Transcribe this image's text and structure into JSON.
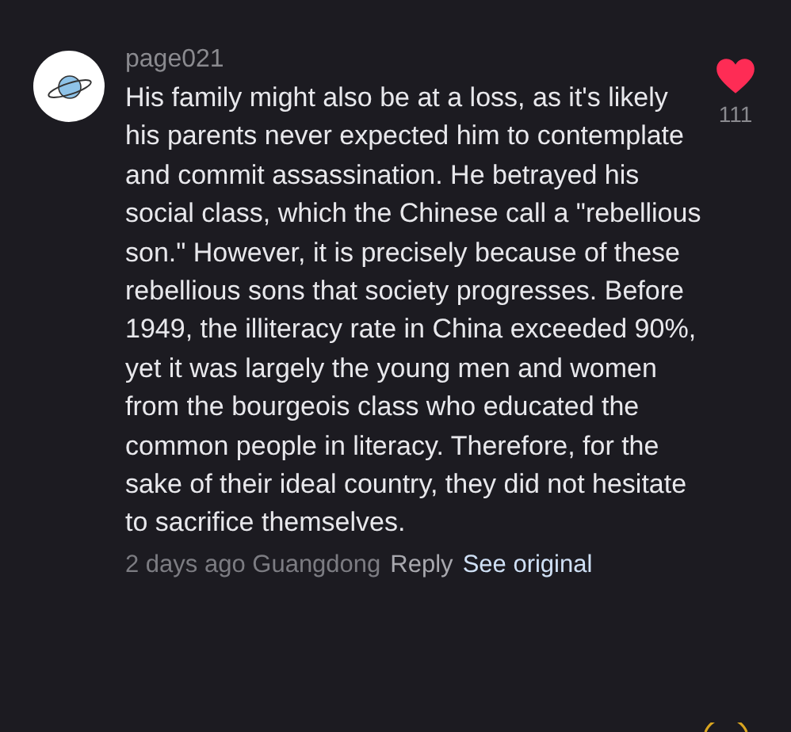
{
  "comment": {
    "username": "page021",
    "text": "His family might also be at a loss, as it's likely his parents never expected him to contemplate and commit assassination. He betrayed his social class, which the Chinese call a \"rebellious son.\" However, it is precisely because of these rebellious sons that society progresses. Before 1949, the illiteracy rate in China exceeded 90%, yet it was largely the young men and women from the bourgeois class who educated the common people in literacy. Therefore, for the sake of their ideal country, they did not hesitate to sacrifice themselves.",
    "liked": true,
    "like_count": "111",
    "meta": "2 days ago Guangdong",
    "reply": "Reply",
    "see_original": "See original"
  }
}
